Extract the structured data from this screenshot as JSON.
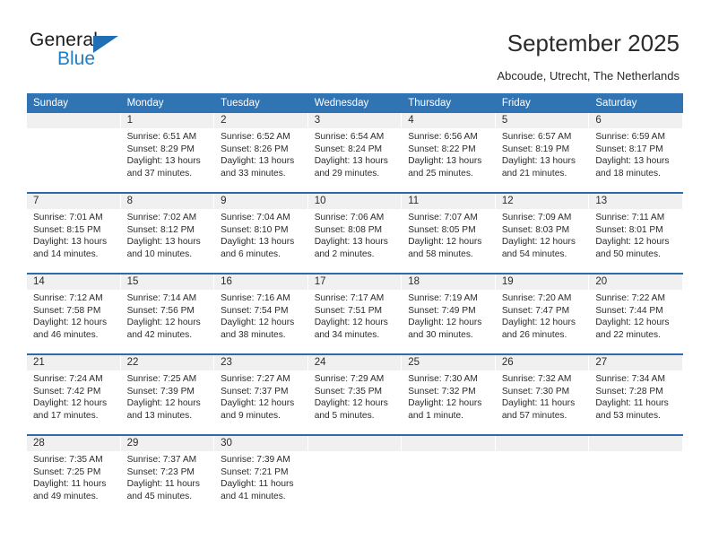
{
  "brand": {
    "name_top": "General",
    "name_bottom": "Blue",
    "accent_color": "#1f7ec4",
    "triangle_color": "#1f6fb5"
  },
  "header": {
    "title": "September 2025",
    "subtitle": "Abcoude, Utrecht, The Netherlands"
  },
  "theme": {
    "header_row_bg": "#3174b4",
    "header_row_text": "#ffffff",
    "week_separator": "#2d6ca8",
    "daynum_band_bg": "#f0f0f0",
    "cell_bg": "#ffffff",
    "text_color": "#2b2b2b"
  },
  "weekdays": [
    "Sunday",
    "Monday",
    "Tuesday",
    "Wednesday",
    "Thursday",
    "Friday",
    "Saturday"
  ],
  "weeks": [
    [
      {
        "day": "",
        "sunrise": "",
        "sunset": "",
        "daylight_line1": "",
        "daylight_line2": "",
        "empty": true
      },
      {
        "day": "1",
        "sunrise": "Sunrise: 6:51 AM",
        "sunset": "Sunset: 8:29 PM",
        "daylight_line1": "Daylight: 13 hours",
        "daylight_line2": "and 37 minutes."
      },
      {
        "day": "2",
        "sunrise": "Sunrise: 6:52 AM",
        "sunset": "Sunset: 8:26 PM",
        "daylight_line1": "Daylight: 13 hours",
        "daylight_line2": "and 33 minutes."
      },
      {
        "day": "3",
        "sunrise": "Sunrise: 6:54 AM",
        "sunset": "Sunset: 8:24 PM",
        "daylight_line1": "Daylight: 13 hours",
        "daylight_line2": "and 29 minutes."
      },
      {
        "day": "4",
        "sunrise": "Sunrise: 6:56 AM",
        "sunset": "Sunset: 8:22 PM",
        "daylight_line1": "Daylight: 13 hours",
        "daylight_line2": "and 25 minutes."
      },
      {
        "day": "5",
        "sunrise": "Sunrise: 6:57 AM",
        "sunset": "Sunset: 8:19 PM",
        "daylight_line1": "Daylight: 13 hours",
        "daylight_line2": "and 21 minutes."
      },
      {
        "day": "6",
        "sunrise": "Sunrise: 6:59 AM",
        "sunset": "Sunset: 8:17 PM",
        "daylight_line1": "Daylight: 13 hours",
        "daylight_line2": "and 18 minutes."
      }
    ],
    [
      {
        "day": "7",
        "sunrise": "Sunrise: 7:01 AM",
        "sunset": "Sunset: 8:15 PM",
        "daylight_line1": "Daylight: 13 hours",
        "daylight_line2": "and 14 minutes."
      },
      {
        "day": "8",
        "sunrise": "Sunrise: 7:02 AM",
        "sunset": "Sunset: 8:12 PM",
        "daylight_line1": "Daylight: 13 hours",
        "daylight_line2": "and 10 minutes."
      },
      {
        "day": "9",
        "sunrise": "Sunrise: 7:04 AM",
        "sunset": "Sunset: 8:10 PM",
        "daylight_line1": "Daylight: 13 hours",
        "daylight_line2": "and 6 minutes."
      },
      {
        "day": "10",
        "sunrise": "Sunrise: 7:06 AM",
        "sunset": "Sunset: 8:08 PM",
        "daylight_line1": "Daylight: 13 hours",
        "daylight_line2": "and 2 minutes."
      },
      {
        "day": "11",
        "sunrise": "Sunrise: 7:07 AM",
        "sunset": "Sunset: 8:05 PM",
        "daylight_line1": "Daylight: 12 hours",
        "daylight_line2": "and 58 minutes."
      },
      {
        "day": "12",
        "sunrise": "Sunrise: 7:09 AM",
        "sunset": "Sunset: 8:03 PM",
        "daylight_line1": "Daylight: 12 hours",
        "daylight_line2": "and 54 minutes."
      },
      {
        "day": "13",
        "sunrise": "Sunrise: 7:11 AM",
        "sunset": "Sunset: 8:01 PM",
        "daylight_line1": "Daylight: 12 hours",
        "daylight_line2": "and 50 minutes."
      }
    ],
    [
      {
        "day": "14",
        "sunrise": "Sunrise: 7:12 AM",
        "sunset": "Sunset: 7:58 PM",
        "daylight_line1": "Daylight: 12 hours",
        "daylight_line2": "and 46 minutes."
      },
      {
        "day": "15",
        "sunrise": "Sunrise: 7:14 AM",
        "sunset": "Sunset: 7:56 PM",
        "daylight_line1": "Daylight: 12 hours",
        "daylight_line2": "and 42 minutes."
      },
      {
        "day": "16",
        "sunrise": "Sunrise: 7:16 AM",
        "sunset": "Sunset: 7:54 PM",
        "daylight_line1": "Daylight: 12 hours",
        "daylight_line2": "and 38 minutes."
      },
      {
        "day": "17",
        "sunrise": "Sunrise: 7:17 AM",
        "sunset": "Sunset: 7:51 PM",
        "daylight_line1": "Daylight: 12 hours",
        "daylight_line2": "and 34 minutes."
      },
      {
        "day": "18",
        "sunrise": "Sunrise: 7:19 AM",
        "sunset": "Sunset: 7:49 PM",
        "daylight_line1": "Daylight: 12 hours",
        "daylight_line2": "and 30 minutes."
      },
      {
        "day": "19",
        "sunrise": "Sunrise: 7:20 AM",
        "sunset": "Sunset: 7:47 PM",
        "daylight_line1": "Daylight: 12 hours",
        "daylight_line2": "and 26 minutes."
      },
      {
        "day": "20",
        "sunrise": "Sunrise: 7:22 AM",
        "sunset": "Sunset: 7:44 PM",
        "daylight_line1": "Daylight: 12 hours",
        "daylight_line2": "and 22 minutes."
      }
    ],
    [
      {
        "day": "21",
        "sunrise": "Sunrise: 7:24 AM",
        "sunset": "Sunset: 7:42 PM",
        "daylight_line1": "Daylight: 12 hours",
        "daylight_line2": "and 17 minutes."
      },
      {
        "day": "22",
        "sunrise": "Sunrise: 7:25 AM",
        "sunset": "Sunset: 7:39 PM",
        "daylight_line1": "Daylight: 12 hours",
        "daylight_line2": "and 13 minutes."
      },
      {
        "day": "23",
        "sunrise": "Sunrise: 7:27 AM",
        "sunset": "Sunset: 7:37 PM",
        "daylight_line1": "Daylight: 12 hours",
        "daylight_line2": "and 9 minutes."
      },
      {
        "day": "24",
        "sunrise": "Sunrise: 7:29 AM",
        "sunset": "Sunset: 7:35 PM",
        "daylight_line1": "Daylight: 12 hours",
        "daylight_line2": "and 5 minutes."
      },
      {
        "day": "25",
        "sunrise": "Sunrise: 7:30 AM",
        "sunset": "Sunset: 7:32 PM",
        "daylight_line1": "Daylight: 12 hours",
        "daylight_line2": "and 1 minute."
      },
      {
        "day": "26",
        "sunrise": "Sunrise: 7:32 AM",
        "sunset": "Sunset: 7:30 PM",
        "daylight_line1": "Daylight: 11 hours",
        "daylight_line2": "and 57 minutes."
      },
      {
        "day": "27",
        "sunrise": "Sunrise: 7:34 AM",
        "sunset": "Sunset: 7:28 PM",
        "daylight_line1": "Daylight: 11 hours",
        "daylight_line2": "and 53 minutes."
      }
    ],
    [
      {
        "day": "28",
        "sunrise": "Sunrise: 7:35 AM",
        "sunset": "Sunset: 7:25 PM",
        "daylight_line1": "Daylight: 11 hours",
        "daylight_line2": "and 49 minutes."
      },
      {
        "day": "29",
        "sunrise": "Sunrise: 7:37 AM",
        "sunset": "Sunset: 7:23 PM",
        "daylight_line1": "Daylight: 11 hours",
        "daylight_line2": "and 45 minutes."
      },
      {
        "day": "30",
        "sunrise": "Sunrise: 7:39 AM",
        "sunset": "Sunset: 7:21 PM",
        "daylight_line1": "Daylight: 11 hours",
        "daylight_line2": "and 41 minutes."
      },
      {
        "day": "",
        "sunrise": "",
        "sunset": "",
        "daylight_line1": "",
        "daylight_line2": "",
        "empty": true
      },
      {
        "day": "",
        "sunrise": "",
        "sunset": "",
        "daylight_line1": "",
        "daylight_line2": "",
        "empty": true
      },
      {
        "day": "",
        "sunrise": "",
        "sunset": "",
        "daylight_line1": "",
        "daylight_line2": "",
        "empty": true
      },
      {
        "day": "",
        "sunrise": "",
        "sunset": "",
        "daylight_line1": "",
        "daylight_line2": "",
        "empty": true
      }
    ]
  ]
}
